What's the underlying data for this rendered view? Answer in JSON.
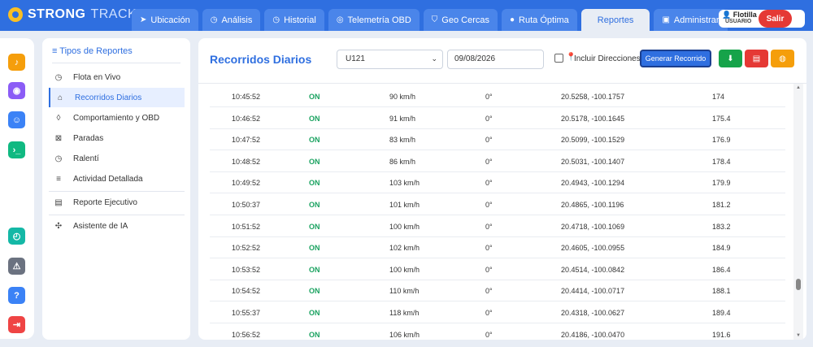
{
  "brand": {
    "strong": "STRONG",
    "track": "TRACK"
  },
  "tabs": [
    {
      "label": "Ubicación",
      "icon": "send-icon",
      "glyph": "➤"
    },
    {
      "label": "Análisis",
      "icon": "gauge-icon",
      "glyph": "◷"
    },
    {
      "label": "Historial",
      "icon": "clock-icon",
      "glyph": "◷"
    },
    {
      "label": "Telemetría OBD",
      "icon": "globe-icon",
      "glyph": "◎"
    },
    {
      "label": "Geo Cercas",
      "icon": "shield-icon",
      "glyph": "⛉"
    },
    {
      "label": "Ruta Óptima",
      "icon": "route-icon",
      "glyph": "●"
    },
    {
      "label": "Reportes",
      "icon": "",
      "glyph": ""
    },
    {
      "label": "Administrar",
      "icon": "window-icon",
      "glyph": "▣"
    }
  ],
  "user": {
    "name": "Flotilla",
    "role": "USUARIO",
    "logout": "Salir"
  },
  "rail": [
    {
      "icon": "bell-icon",
      "glyph": "♪",
      "color": "#f59e0b"
    },
    {
      "icon": "map-pin-icon",
      "glyph": "◉",
      "color": "#8b5cf6"
    },
    {
      "icon": "user-icon",
      "glyph": "☺",
      "color": "#3b82f6"
    },
    {
      "icon": "terminal-icon",
      "glyph": "›_",
      "color": "#10b981"
    },
    {
      "icon": "timer-icon",
      "glyph": "◴",
      "color": "#14b8a6"
    },
    {
      "icon": "alert-icon",
      "glyph": "⚠",
      "color": "#6b7280"
    },
    {
      "icon": "help-icon",
      "glyph": "?",
      "color": "#3b82f6"
    },
    {
      "icon": "exit-icon",
      "glyph": "⇥",
      "color": "#ef4444"
    }
  ],
  "sidebar": {
    "title": "Tipos de Reportes",
    "items": [
      {
        "label": "Flota en Vivo",
        "icon": "clock-icon",
        "glyph": "◷"
      },
      {
        "label": "Recorridos Diarios",
        "icon": "home-icon",
        "glyph": "⌂"
      },
      {
        "label": "Comportamiento y OBD",
        "icon": "leaf-icon",
        "glyph": "◊"
      },
      {
        "label": "Paradas",
        "icon": "stop-icon",
        "glyph": "⊠"
      },
      {
        "label": "Ralentí",
        "icon": "clock-icon",
        "glyph": "◷"
      },
      {
        "label": "Actividad Detallada",
        "icon": "list-icon",
        "glyph": "≡"
      },
      {
        "label": "Reporte Ejecutivo",
        "icon": "table-icon",
        "glyph": "▤"
      },
      {
        "label": "Asistente de IA",
        "icon": "network-icon",
        "glyph": "✣"
      }
    ]
  },
  "main": {
    "title": "Recorridos Diarios",
    "vehicle": "U121",
    "date": "09/08/2026",
    "include_directions": "Incluir Direcciones",
    "generate": "Generar Recorrido",
    "actions": [
      {
        "icon": "download-icon",
        "glyph": "⬇",
        "color": "#16a34a"
      },
      {
        "icon": "pdf-icon",
        "glyph": "▤",
        "color": "#e53935"
      },
      {
        "icon": "globe-icon",
        "glyph": "◍",
        "color": "#f59e0b"
      }
    ]
  },
  "rows": [
    {
      "time": "10:45:52",
      "status": "ON",
      "speed": "90 km/h",
      "heading": "0°",
      "coords": "20.5258, -100.1757",
      "odometer": "174"
    },
    {
      "time": "10:46:52",
      "status": "ON",
      "speed": "91 km/h",
      "heading": "0°",
      "coords": "20.5178, -100.1645",
      "odometer": "175.4"
    },
    {
      "time": "10:47:52",
      "status": "ON",
      "speed": "83 km/h",
      "heading": "0°",
      "coords": "20.5099, -100.1529",
      "odometer": "176.9"
    },
    {
      "time": "10:48:52",
      "status": "ON",
      "speed": "86 km/h",
      "heading": "0°",
      "coords": "20.5031, -100.1407",
      "odometer": "178.4"
    },
    {
      "time": "10:49:52",
      "status": "ON",
      "speed": "103 km/h",
      "heading": "0°",
      "coords": "20.4943, -100.1294",
      "odometer": "179.9"
    },
    {
      "time": "10:50:37",
      "status": "ON",
      "speed": "101 km/h",
      "heading": "0°",
      "coords": "20.4865, -100.1196",
      "odometer": "181.2"
    },
    {
      "time": "10:51:52",
      "status": "ON",
      "speed": "100 km/h",
      "heading": "0°",
      "coords": "20.4718, -100.1069",
      "odometer": "183.2"
    },
    {
      "time": "10:52:52",
      "status": "ON",
      "speed": "102 km/h",
      "heading": "0°",
      "coords": "20.4605, -100.0955",
      "odometer": "184.9"
    },
    {
      "time": "10:53:52",
      "status": "ON",
      "speed": "100 km/h",
      "heading": "0°",
      "coords": "20.4514, -100.0842",
      "odometer": "186.4"
    },
    {
      "time": "10:54:52",
      "status": "ON",
      "speed": "110 km/h",
      "heading": "0°",
      "coords": "20.4414, -100.0717",
      "odometer": "188.1"
    },
    {
      "time": "10:55:37",
      "status": "ON",
      "speed": "118 km/h",
      "heading": "0°",
      "coords": "20.4318, -100.0627",
      "odometer": "189.4"
    },
    {
      "time": "10:56:52",
      "status": "ON",
      "speed": "106 km/h",
      "heading": "0°",
      "coords": "20.4186, -100.0470",
      "odometer": "191.6"
    }
  ]
}
